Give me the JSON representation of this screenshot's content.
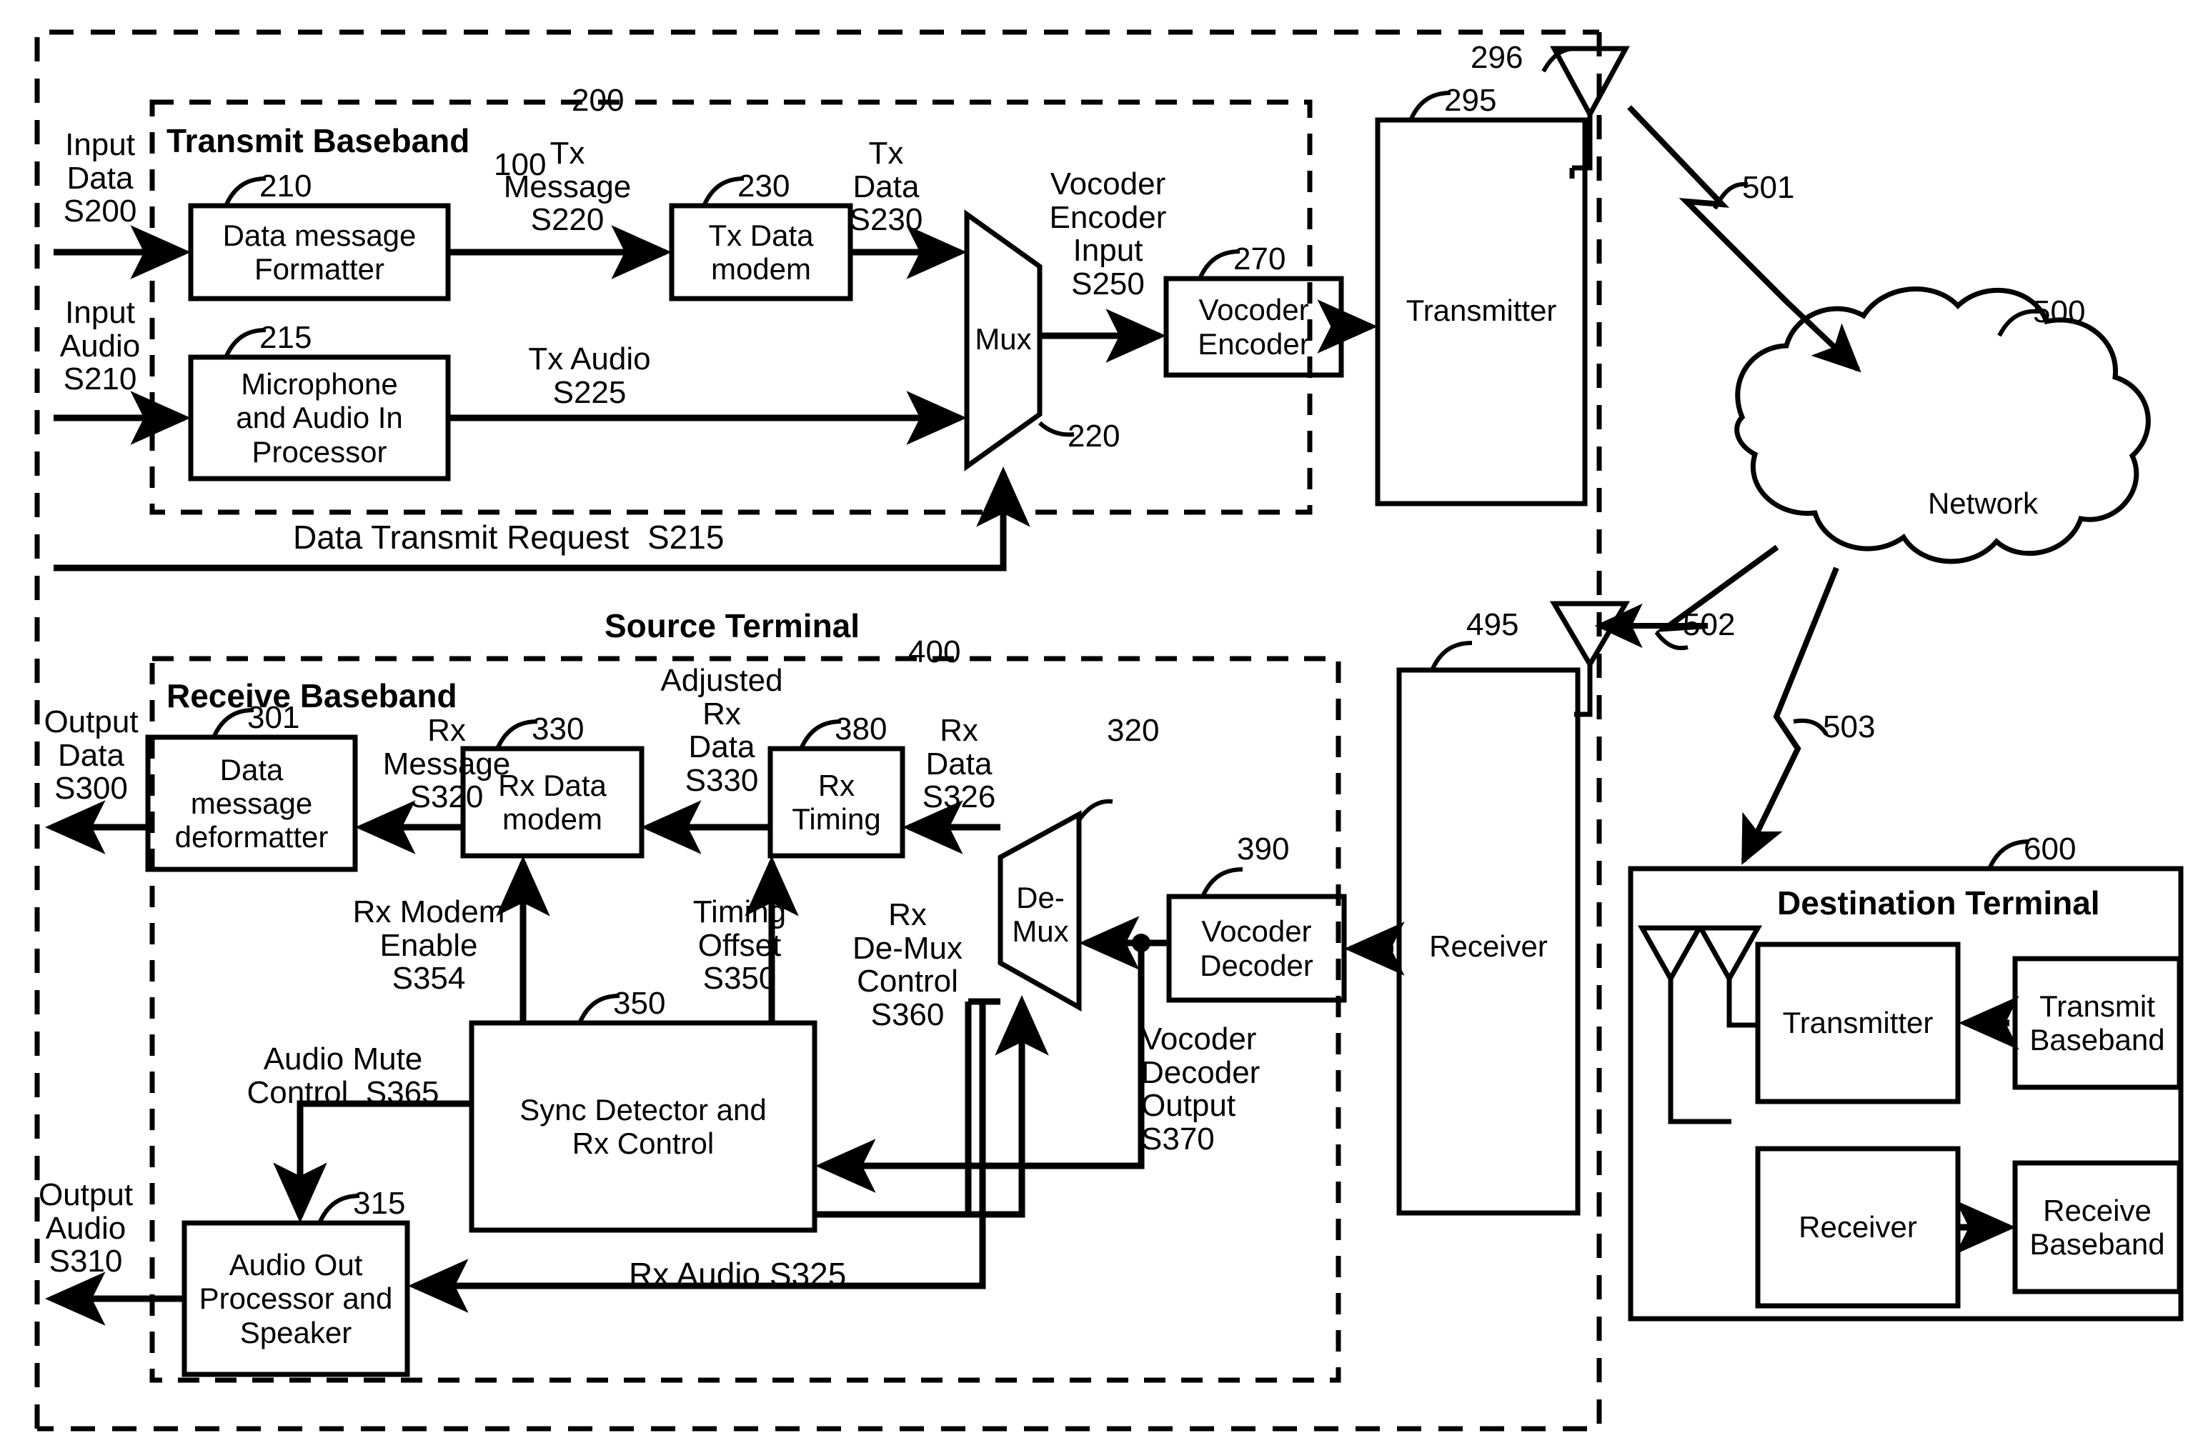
{
  "figure": {
    "type": "patent-block-diagram",
    "background": "#ffffff",
    "line_color": "#000000"
  },
  "ref_numerals": {
    "system": "100",
    "transmit_baseband": "200",
    "data_message_formatter": "210",
    "microphone_audio_in": "215",
    "mux": "220",
    "tx_data_modem": "230",
    "vocoder_encoder": "270",
    "transmitter": "295",
    "tx_antenna": "296",
    "data_message_deformatter": "301",
    "audio_out_processor": "315",
    "demux": "320",
    "rx_data_modem": "330",
    "sync_detector": "350",
    "rx_timing": "380",
    "vocoder_decoder": "390",
    "receive_baseband": "400",
    "receiver": "495",
    "network": "500",
    "link_501": "501",
    "link_502": "502",
    "link_503": "503",
    "destination_terminal": "600"
  },
  "titles": {
    "transmit_baseband": "Transmit Baseband",
    "receive_baseband": "Receive Baseband",
    "source_terminal": "Source Terminal",
    "destination_terminal": "Destination Terminal"
  },
  "blocks": {
    "data_message_formatter": "Data message\nFormatter",
    "microphone_audio_in": "Microphone\nand Audio In\nProcessor",
    "tx_data_modem": "Tx Data\nmodem",
    "mux": "Mux",
    "vocoder_encoder": "Vocoder\nEncoder",
    "transmitter": "Transmitter",
    "network": "Network",
    "data_message_deformatter": "Data\nmessage\ndeformatter",
    "rx_data_modem": "Rx Data\nmodem",
    "rx_timing": "Rx\nTiming",
    "demux": "De-\nMux",
    "vocoder_decoder": "Vocoder\nDecoder",
    "receiver": "Receiver",
    "sync_detector": "Sync Detector and\nRx Control",
    "audio_out": "Audio Out\nProcessor and\nSpeaker",
    "dest_transmitter": "Transmitter",
    "dest_transmit_baseband": "Transmit\nBaseband",
    "dest_receiver": "Receiver",
    "dest_receive_baseband": "Receive\nBaseband"
  },
  "signals": {
    "input_data": "Input\nData\nS200",
    "input_audio": "Input\nAudio\nS210",
    "tx_message": "Tx\nMessage\nS220",
    "tx_data": "Tx\nData\nS230",
    "tx_audio": "Tx Audio\nS225",
    "vocoder_encoder_input": "Vocoder\nEncoder\nInput\nS250",
    "data_transmit_request": "Data Transmit Request  S215",
    "output_data": "Output\nData\nS300",
    "rx_message": "Rx\nMessage\nS320",
    "adjusted_rx_data": "Adjusted\nRx\nData\nS330",
    "rx_data_s326": "Rx\nData\nS326",
    "rx_modem_enable": "Rx Modem\nEnable\nS354",
    "timing_offset": "Timing\nOffset\nS350",
    "rx_demux_control": "Rx\nDe-Mux\nControl\nS360",
    "vocoder_decoder_output": "Vocoder\nDecoder\nOutput\nS370",
    "audio_mute_control": "Audio Mute\nControl  S365",
    "output_audio": "Output\nAudio\nS310",
    "rx_audio": "Rx Audio S325"
  }
}
